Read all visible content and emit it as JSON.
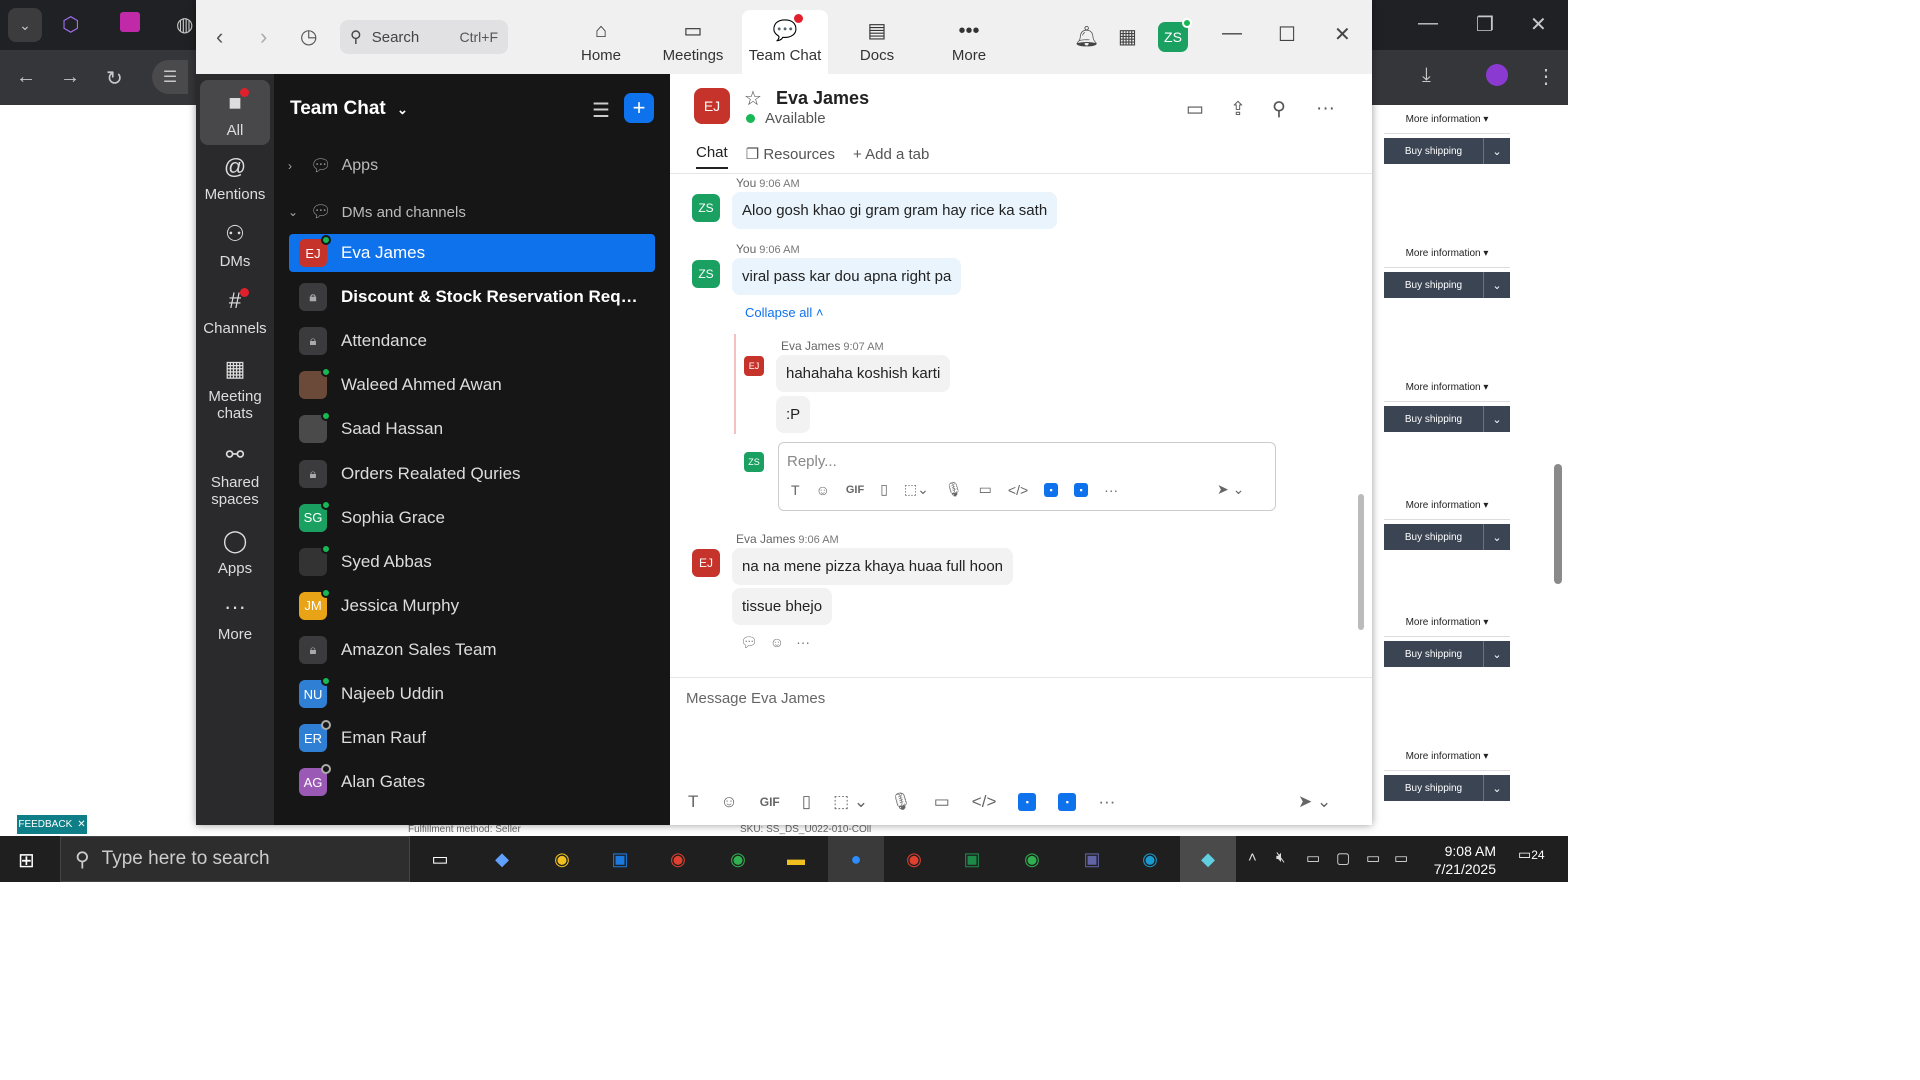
{
  "browser": {
    "right_panel": {
      "more_info_label": "More information ▾",
      "buy_shipping_label": "Buy shipping",
      "rows": [
        1,
        2,
        3,
        4,
        5,
        6
      ]
    },
    "feedback_label": "FEEDBACK",
    "feedback_close": "✕",
    "footer_text_1": "Fulfillment method: Seller",
    "footer_text_2": "SKU: SS_DS_U022-010-COll"
  },
  "zoom": {
    "search": {
      "label": "Search",
      "shortcut": "Ctrl+F"
    },
    "tabs": [
      {
        "label": "Home"
      },
      {
        "label": "Meetings"
      },
      {
        "label": "Team Chat"
      },
      {
        "label": "Docs"
      },
      {
        "label": "More"
      }
    ],
    "user_initials": "ZS",
    "rail": [
      {
        "label": "All"
      },
      {
        "label": "Mentions"
      },
      {
        "label": "DMs"
      },
      {
        "label": "Channels"
      },
      {
        "label": "Meeting chats"
      },
      {
        "label": "Shared spaces"
      },
      {
        "label": "Apps"
      },
      {
        "label": "More"
      }
    ],
    "sidebar": {
      "title": "Team Chat",
      "sections": {
        "apps": "Apps",
        "dms": "DMs and channels"
      },
      "items": [
        {
          "name": "Eva James",
          "initials": "EJ",
          "color": "#c6332b"
        },
        {
          "name": "Discount & Stock Reservation Reque...",
          "initials": ""
        },
        {
          "name": "Attendance",
          "initials": ""
        },
        {
          "name": "Waleed Ahmed Awan",
          "initials": "",
          "color": "#6b4a3a"
        },
        {
          "name": "Saad Hassan",
          "initials": "",
          "color": "#4a4a4a"
        },
        {
          "name": "Orders Realated Quries",
          "initials": ""
        },
        {
          "name": "Sophia Grace",
          "initials": "SG",
          "color": "#1aa162"
        },
        {
          "name": "Syed Abbas",
          "initials": "",
          "color": "#333333"
        },
        {
          "name": "Jessica Murphy",
          "initials": "JM",
          "color": "#e8a317"
        },
        {
          "name": "Amazon Sales Team",
          "initials": ""
        },
        {
          "name": "Najeeb Uddin",
          "initials": "NU",
          "color": "#2f7fd4"
        },
        {
          "name": "Eman Rauf",
          "initials": "ER",
          "color": "#2f7fd4"
        },
        {
          "name": "Alan Gates",
          "initials": "AG",
          "color": "#9b59b6"
        }
      ]
    },
    "chat": {
      "contact_initials": "EJ",
      "contact_name": "Eva James",
      "status": "Available",
      "tabs": {
        "chat": "Chat",
        "resources": "Resources",
        "add": "Add a tab"
      },
      "messages": [
        {
          "sender": "You",
          "time": "9:06 AM",
          "initials": "ZS",
          "text": "Aloo gosh khao gi gram gram hay rice ka sath"
        },
        {
          "sender": "You",
          "time": "9:06 AM",
          "initials": "ZS",
          "text": "viral pass kar dou apna right pa"
        }
      ],
      "collapse_all": "Collapse all",
      "thread": {
        "sender": "Eva James",
        "time": "9:07 AM",
        "initials": "EJ",
        "lines": [
          "hahahaha koshish karti",
          ":P"
        ],
        "reply_initials": "ZS",
        "reply_placeholder": "Reply..."
      },
      "last_message": {
        "sender": "Eva James",
        "time": "9:06 AM",
        "initials": "EJ",
        "lines": [
          "na na mene pizza khaya huaa full hoon",
          "tissue bhejo"
        ]
      },
      "compose_placeholder": "Message Eva James",
      "gif_label": "GIF"
    }
  },
  "taskbar": {
    "search_placeholder": "Type here to search",
    "time": "9:08 AM",
    "date": "7/21/2025",
    "notifications": "24"
  }
}
